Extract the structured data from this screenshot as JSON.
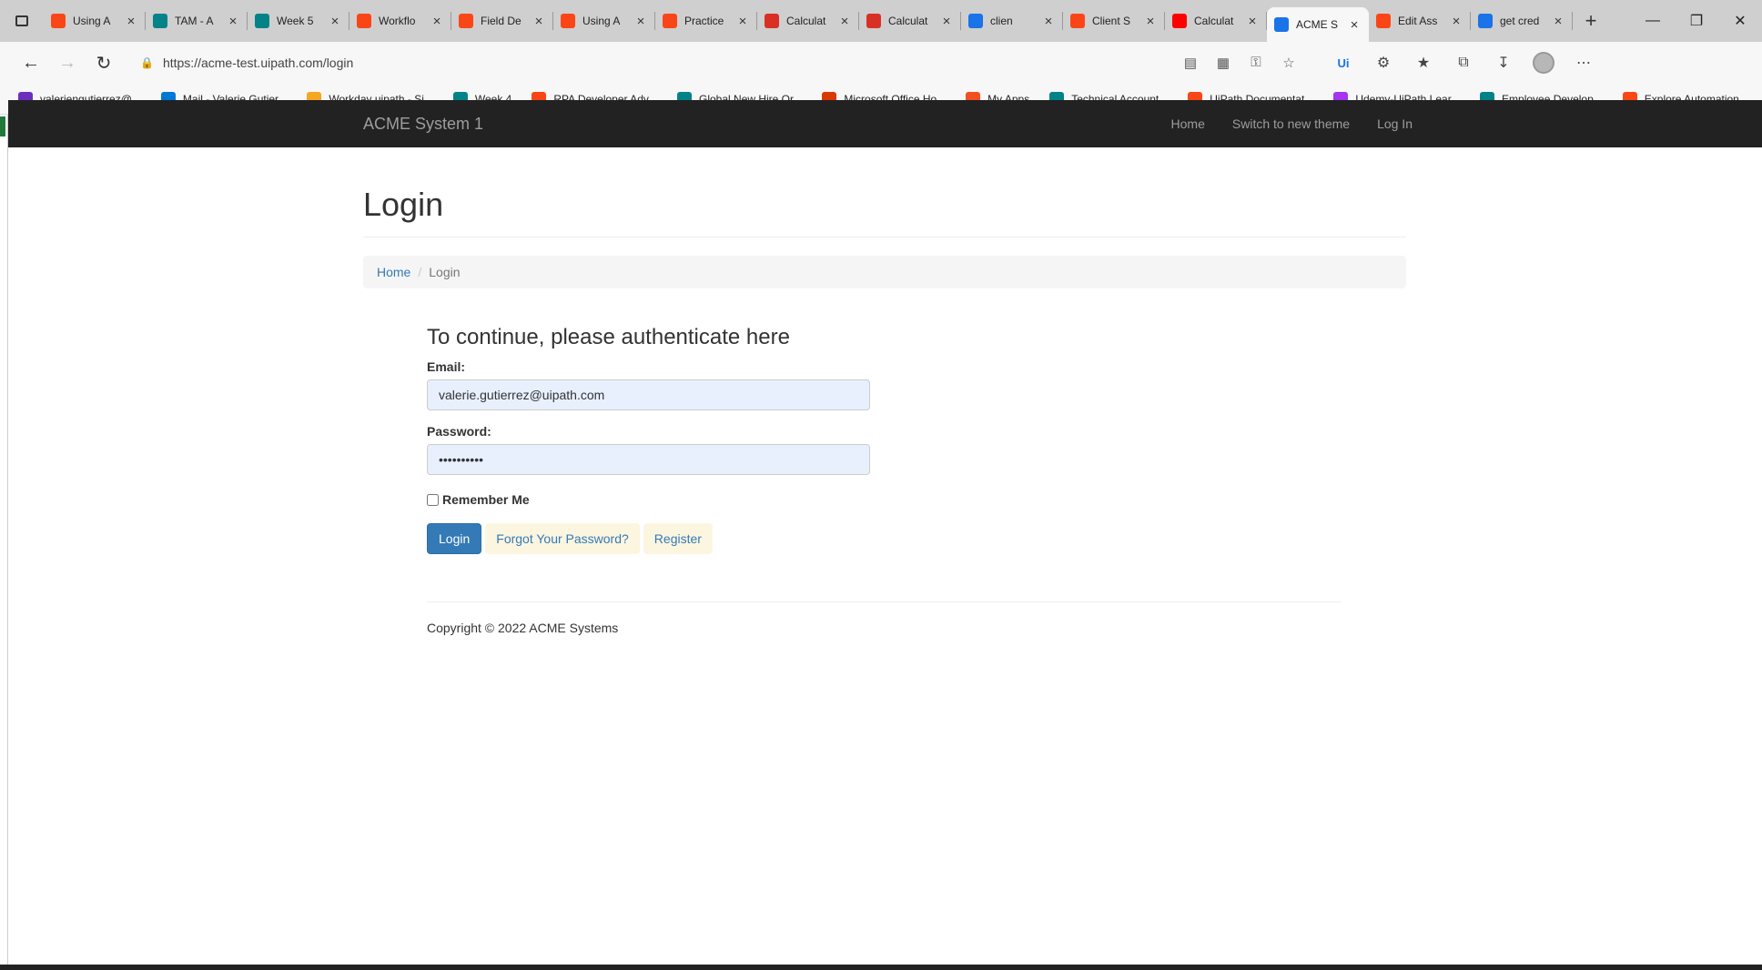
{
  "browser": {
    "tabs": [
      {
        "title": "Using A",
        "favicon": "uipath-icon",
        "color": "#fa4616",
        "active": false
      },
      {
        "title": "TAM - A",
        "favicon": "sharepoint-icon",
        "color": "#038387",
        "active": false
      },
      {
        "title": "Week 5",
        "favicon": "sharepoint-icon",
        "color": "#038387",
        "active": false
      },
      {
        "title": "Workflo",
        "favicon": "uipath-icon",
        "color": "#fa4616",
        "active": false
      },
      {
        "title": "Field De",
        "favicon": "uipath-icon",
        "color": "#fa4616",
        "active": false
      },
      {
        "title": "Using A",
        "favicon": "uipath-icon",
        "color": "#fa4616",
        "active": false
      },
      {
        "title": "Practice",
        "favicon": "uipath-icon",
        "color": "#fa4616",
        "active": false
      },
      {
        "title": "Calculat",
        "favicon": "pdf-icon",
        "color": "#d93025",
        "active": false
      },
      {
        "title": "Calculat",
        "favicon": "pdf-icon",
        "color": "#d93025",
        "active": false
      },
      {
        "title": "clien",
        "favicon": "bing-icon",
        "color": "#1a73e8",
        "active": false
      },
      {
        "title": "Client S",
        "favicon": "uipath-icon",
        "color": "#fa4616",
        "active": false
      },
      {
        "title": "Calculat",
        "favicon": "youtube-icon",
        "color": "#ff0000",
        "active": false
      },
      {
        "title": "ACME S",
        "favicon": "uipath-icon",
        "color": "#1a73e8",
        "active": true
      },
      {
        "title": "Edit Ass",
        "favicon": "uipath-icon",
        "color": "#fa4616",
        "active": false
      },
      {
        "title": "get cred",
        "favicon": "bing-icon",
        "color": "#1a73e8",
        "active": false
      }
    ],
    "url": "https://acme-test.uipath.com/login",
    "bookmarks": [
      {
        "label": "valeriengutierrez@...",
        "favicon": "mail-icon",
        "color": "#6b2fbf"
      },
      {
        "label": "Mail - Valerie Gutier...",
        "favicon": "outlook-icon",
        "color": "#0078d4"
      },
      {
        "label": "Workday uipath - Si...",
        "favicon": "workday-icon",
        "color": "#f5a623"
      },
      {
        "label": "Week 4",
        "favicon": "sharepoint-icon",
        "color": "#038387"
      },
      {
        "label": "RPA Developer Adv...",
        "favicon": "uipath-icon",
        "color": "#fa4616"
      },
      {
        "label": "Global New Hire Or...",
        "favicon": "sharepoint-icon",
        "color": "#038387"
      },
      {
        "label": "Microsoft Office Ho...",
        "favicon": "office-icon",
        "color": "#d83b01"
      },
      {
        "label": "My Apps",
        "favicon": "apps-grid-icon",
        "color": "#f25022"
      },
      {
        "label": "Technical Account...",
        "favicon": "sharepoint-icon",
        "color": "#038387"
      },
      {
        "label": "UiPath Documentat...",
        "favicon": "uipath-icon",
        "color": "#fa4616"
      },
      {
        "label": "Udemy-UiPath Lear...",
        "favicon": "udemy-icon",
        "color": "#a435f0"
      },
      {
        "label": "Employee Develop...",
        "favicon": "sharepoint-icon",
        "color": "#038387"
      },
      {
        "label": "Explore Automation...",
        "favicon": "uipath-icon",
        "color": "#fa4616"
      }
    ]
  },
  "site": {
    "brand": "ACME System 1",
    "nav": {
      "home": "Home",
      "switch_theme": "Switch to new theme",
      "login": "Log In"
    }
  },
  "page": {
    "title": "Login",
    "breadcrumb": {
      "home": "Home",
      "current": "Login"
    },
    "form": {
      "heading": "To continue, please authenticate here",
      "email_label": "Email:",
      "email_value": "valerie.gutierrez@uipath.com",
      "password_label": "Password:",
      "password_value": "••••••••••",
      "remember_label": "Remember Me",
      "remember_checked": false,
      "login_button": "Login",
      "forgot_link": "Forgot Your Password?",
      "register_link": "Register"
    },
    "footer": "Copyright © 2022 ACME Systems"
  },
  "colors": {
    "navbar_bg": "#222222",
    "link": "#337ab7",
    "primary_button": "#337ab7",
    "input_autofill_bg": "#e8f0fe"
  }
}
